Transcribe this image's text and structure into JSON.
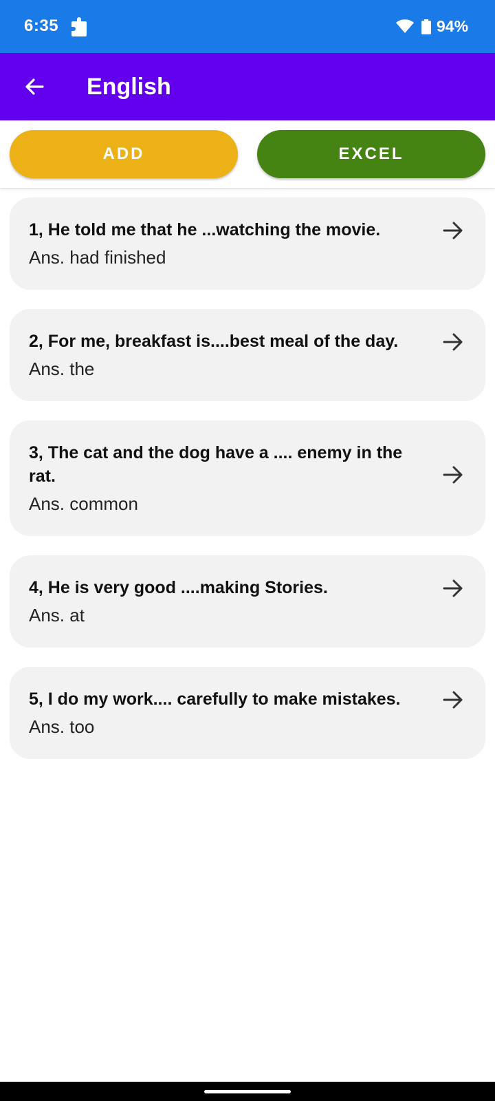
{
  "status_bar": {
    "time": "6:35",
    "battery": "94%",
    "icons": [
      "app-notification-icon",
      "wifi-icon",
      "battery-icon"
    ],
    "background": "#1a7ae8"
  },
  "app_bar": {
    "title": "English",
    "back_icon": "arrow-back-icon",
    "background": "#6200ee"
  },
  "actions": {
    "add_label": "ADD",
    "add_color": "#edb118",
    "excel_label": "EXCEL",
    "excel_color": "#458412"
  },
  "questions": [
    {
      "question": "1, He told me that he ...watching the movie.",
      "answer": "Ans. had finished"
    },
    {
      "question": "2, For me, breakfast is....best meal of the day.",
      "answer": "Ans. the"
    },
    {
      "question": "3, The cat and the dog have a .... enemy in the rat.",
      "answer": "Ans. common"
    },
    {
      "question": "4, He is very good ....making Stories.",
      "answer": "Ans. at"
    },
    {
      "question": "5, I do my work.... carefully to make mistakes.",
      "answer": "Ans. too"
    }
  ],
  "item_icon": "arrow-forward-icon"
}
